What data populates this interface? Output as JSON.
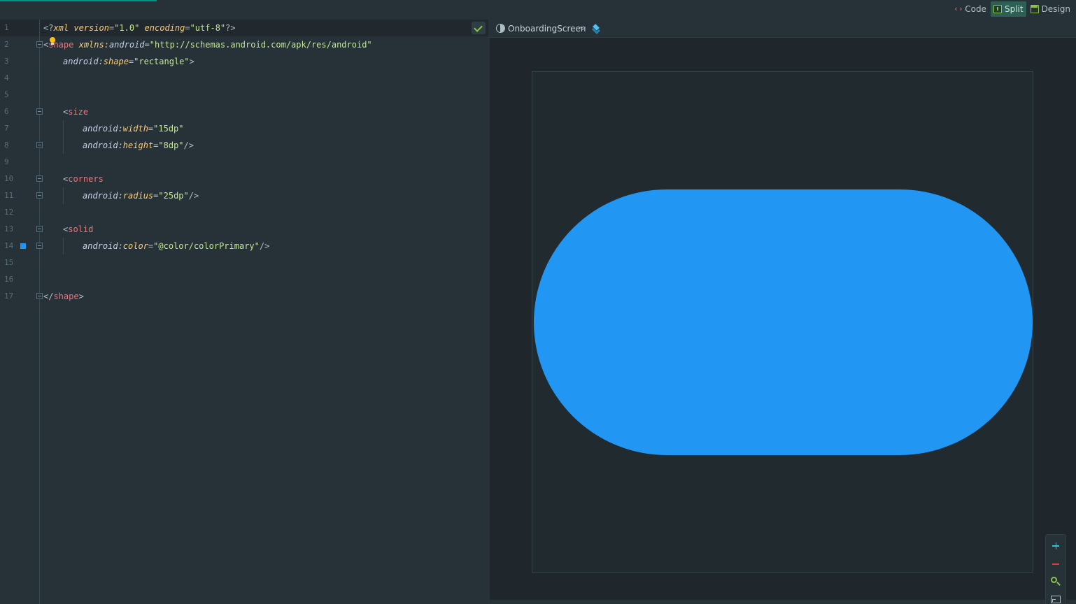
{
  "view_modes": [
    {
      "label": "Code",
      "icon": "code-icon",
      "active": false
    },
    {
      "label": "Split",
      "icon": "split-icon",
      "active": true
    },
    {
      "label": "Design",
      "icon": "design-icon",
      "active": false
    }
  ],
  "editor": {
    "line_numbers": [
      "1",
      "2",
      "3",
      "4",
      "5",
      "6",
      "7",
      "8",
      "9",
      "10",
      "11",
      "12",
      "13",
      "14",
      "15",
      "16",
      "17"
    ],
    "lines": {
      "l1": {
        "open": "<?",
        "pi": "xml",
        "a1": "version",
        "v1": "\"1.0\"",
        "a2": "encoding",
        "v2": "\"utf-8\"",
        "close": "?>"
      },
      "l2": {
        "open": "<",
        "tag": "shape",
        "ns": "xmlns:",
        "attr": "android",
        "eq": "=",
        "val": "\"http://schemas.android.com/apk/res/android\""
      },
      "l3": {
        "ns": "android:",
        "attr": "shape",
        "eq": "=",
        "val": "\"rectangle\"",
        "close": ">"
      },
      "l6": {
        "open": "<",
        "tag": "size"
      },
      "l7": {
        "ns": "android:",
        "attr": "width",
        "eq": "=",
        "val": "\"15dp\""
      },
      "l8": {
        "ns": "android:",
        "attr": "height",
        "eq": "=",
        "val": "\"8dp\"",
        "close": "/>"
      },
      "l10": {
        "open": "<",
        "tag": "corners"
      },
      "l11": {
        "ns": "android:",
        "attr": "radius",
        "eq": "=",
        "val": "\"25dp\"",
        "close": "/>"
      },
      "l13": {
        "open": "<",
        "tag": "solid"
      },
      "l14": {
        "ns": "android:",
        "attr": "color",
        "eq": "=",
        "val": "\"@color/colorPrimary\"",
        "close": "/>"
      },
      "l17": {
        "open": "</",
        "tag": "shape",
        "close": ">"
      }
    },
    "gutter_color_chip": "#2196f3"
  },
  "design": {
    "device": "OnboardingScreen",
    "preview_color": "#2196f3"
  },
  "zoom_controls": [
    "zoom-in",
    "zoom-out",
    "zoom-to-fit",
    "actual-size"
  ]
}
